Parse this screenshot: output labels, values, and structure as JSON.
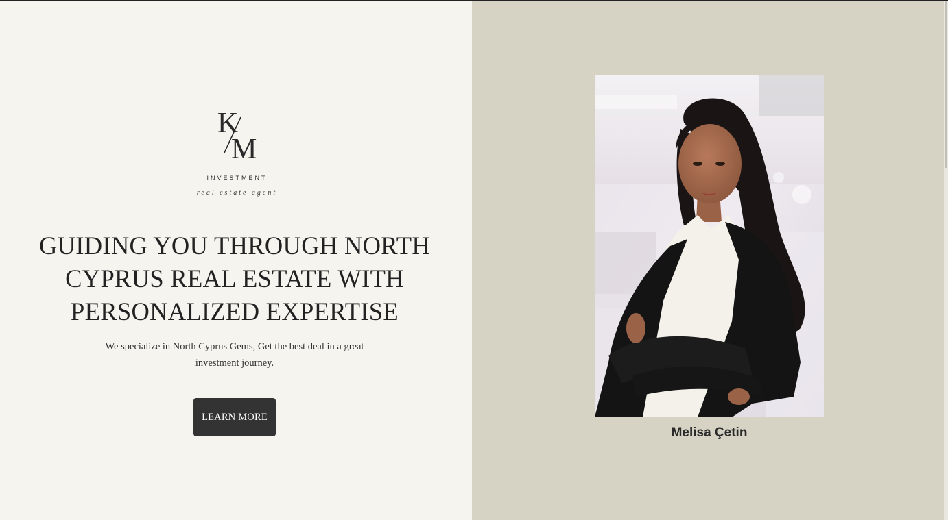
{
  "logo": {
    "monogram_left": "K",
    "monogram_right": "M",
    "wordmark": "INVESTMENT",
    "tagline": "real estate agent"
  },
  "hero": {
    "headline": "GUIDING YOU THROUGH NORTH CYPRUS REAL ESTATE WITH PERSONALIZED EXPERTISE",
    "subtext": "We specialize in North Cyprus Gems, Get the best deal in a great investment journey.",
    "cta_label": "LEARN MORE"
  },
  "agent": {
    "name": "Melisa Çetin"
  },
  "colors": {
    "left_background": "#f6f4ef",
    "right_background": "#d6d3c4",
    "button_background": "#333333",
    "text_dark": "#222222"
  }
}
